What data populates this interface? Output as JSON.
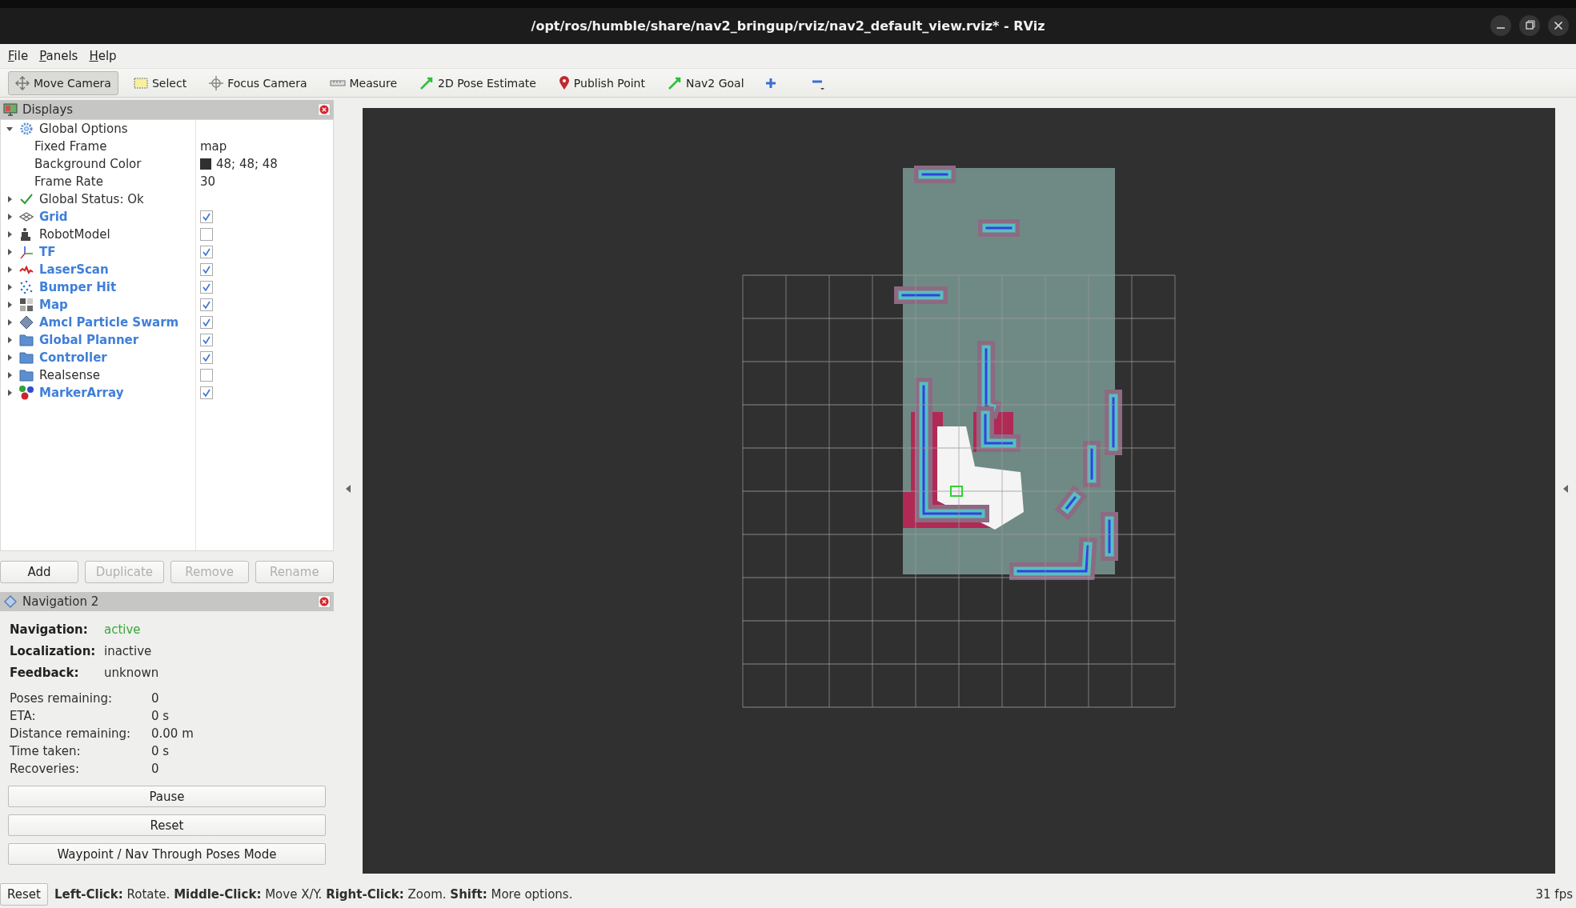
{
  "window": {
    "title": "/opt/ros/humble/share/nav2_bringup/rviz/nav2_default_view.rviz* - RViz"
  },
  "menu": [
    "File",
    "Panels",
    "Help"
  ],
  "toolbar": {
    "tools": [
      {
        "label": "Move Camera",
        "kind": "move",
        "selected": true
      },
      {
        "label": "Select",
        "kind": "select",
        "selected": false
      },
      {
        "label": "Focus Camera",
        "kind": "focus",
        "selected": false
      },
      {
        "label": "Measure",
        "kind": "measure",
        "selected": false
      },
      {
        "label": "2D Pose Estimate",
        "kind": "pose",
        "selected": false
      },
      {
        "label": "Publish Point",
        "kind": "point",
        "selected": false
      },
      {
        "label": "Nav2 Goal",
        "kind": "goal",
        "selected": false
      }
    ]
  },
  "displays": {
    "title": "Displays",
    "global_options": {
      "label": "Global Options",
      "expanded": true,
      "children": [
        {
          "label": "Fixed Frame",
          "value": "map"
        },
        {
          "label": "Background Color",
          "value": "48; 48; 48",
          "color": "#303030"
        },
        {
          "label": "Frame Rate",
          "value": "30"
        }
      ]
    },
    "global_status": {
      "label": "Global Status: Ok",
      "expanded": false
    },
    "items": [
      {
        "label": "Grid",
        "kind": "grid",
        "checked": true,
        "expanded": false
      },
      {
        "label": "RobotModel",
        "kind": "robot",
        "checked": false,
        "expanded": false
      },
      {
        "label": "TF",
        "kind": "tf",
        "checked": true,
        "expanded": false
      },
      {
        "label": "LaserScan",
        "kind": "laser",
        "checked": true,
        "expanded": false
      },
      {
        "label": "Bumper Hit",
        "kind": "points",
        "checked": true,
        "expanded": false
      },
      {
        "label": "Map",
        "kind": "map",
        "checked": true,
        "expanded": false
      },
      {
        "label": "Amcl Particle Swarm",
        "kind": "diamond",
        "checked": true,
        "expanded": false
      },
      {
        "label": "Global Planner",
        "kind": "folder",
        "checked": true,
        "expanded": false
      },
      {
        "label": "Controller",
        "kind": "folder",
        "checked": true,
        "expanded": false
      },
      {
        "label": "Realsense",
        "kind": "folder",
        "checked": false,
        "expanded": false
      },
      {
        "label": "MarkerArray",
        "kind": "markers",
        "checked": true,
        "expanded": false
      }
    ],
    "buttons": [
      {
        "label": "Add",
        "disabled": false
      },
      {
        "label": "Duplicate",
        "disabled": true
      },
      {
        "label": "Remove",
        "disabled": true
      },
      {
        "label": "Rename",
        "disabled": true
      }
    ]
  },
  "navigation": {
    "title": "Navigation 2",
    "status": [
      {
        "label": "Navigation:",
        "value": "active",
        "color": "#3aa83a"
      },
      {
        "label": "Localization:",
        "value": "inactive",
        "color": "#2e2e2e"
      },
      {
        "label": "Feedback:",
        "value": "unknown",
        "color": "#2e2e2e"
      }
    ],
    "stats": [
      {
        "label": "Poses remaining:",
        "value": "0"
      },
      {
        "label": "ETA:",
        "value": "0 s"
      },
      {
        "label": "Distance remaining:",
        "value": "0.00 m"
      },
      {
        "label": "Time taken:",
        "value": "0 s"
      },
      {
        "label": "Recoveries:",
        "value": "0"
      }
    ],
    "buttons": [
      "Pause",
      "Reset",
      "Waypoint / Nav Through Poses Mode"
    ]
  },
  "status_bar": {
    "reset_button": "Reset",
    "hint": "**Left-Click:** Rotate. **Middle-Click:** Move X/Y. **Right-Click:** Zoom. **Shift:** More options.",
    "fps": "31 fps"
  }
}
